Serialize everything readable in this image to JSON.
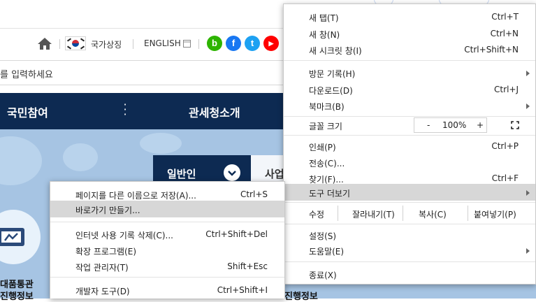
{
  "header": {
    "national_symbol": "국가상징",
    "english": "ENGLISH",
    "english_icon": "window-icon",
    "sns": [
      {
        "name": "blog",
        "glyph": "b",
        "color": "#2db400"
      },
      {
        "name": "facebook",
        "glyph": "f",
        "color": "#1877f2"
      },
      {
        "name": "twitter",
        "glyph": "t",
        "color": "#1da1f2"
      },
      {
        "name": "youtube",
        "glyph": "▶",
        "color": "#ff0000"
      }
    ]
  },
  "search": {
    "placeholder_partial": "를 입력하세요"
  },
  "nav": {
    "item_1": "국민참여",
    "item_2": "관세청소개"
  },
  "tabs": {
    "active": "일반인",
    "inactive": "사업"
  },
  "content": {
    "caption_left_1": "대품통관",
    "caption_left_2": "진행정보",
    "caption_right_1": "진행정보"
  },
  "chrome_menu": {
    "new_tab": {
      "label": "새 탭(T)",
      "shortcut": "Ctrl+T"
    },
    "new_window": {
      "label": "새 창(N)",
      "shortcut": "Ctrl+N"
    },
    "new_incognito": {
      "label": "새 시크릿 창(I)",
      "shortcut": "Ctrl+Shift+N"
    },
    "history": {
      "label": "방문 기록(H)"
    },
    "downloads": {
      "label": "다운로드(D)",
      "shortcut": "Ctrl+J"
    },
    "bookmarks": {
      "label": "북마크(B)"
    },
    "font_size": {
      "label": "글꼴 크기",
      "minus": "-",
      "value": "100%",
      "plus": "+"
    },
    "print": {
      "label": "인쇄(P)",
      "shortcut": "Ctrl+P"
    },
    "cast": {
      "label": "전송(C)..."
    },
    "find": {
      "label": "찾기(F)...",
      "shortcut": "Ctrl+F"
    },
    "more_tools": {
      "label": "도구 더보기"
    },
    "edit": {
      "label": "수정",
      "cut": "잘라내기(T)",
      "copy": "복사(C)",
      "paste": "붙여넣기(P)"
    },
    "settings": {
      "label": "설정(S)"
    },
    "help": {
      "label": "도움말(E)"
    },
    "exit": {
      "label": "종료(X)"
    }
  },
  "tools_submenu": {
    "save_as": {
      "label": "페이지를 다른 이름으로 저장(A)...",
      "shortcut": "Ctrl+S"
    },
    "create_shortcut": {
      "label": "바로가기 만들기..."
    },
    "clear_data": {
      "label": "인터넷 사용 기록 삭제(C)...",
      "shortcut": "Ctrl+Shift+Del"
    },
    "extensions": {
      "label": "확장 프로그램(E)"
    },
    "task_manager": {
      "label": "작업 관리자(T)",
      "shortcut": "Shift+Esc"
    },
    "dev_tools": {
      "label": "개발자 도구(D)",
      "shortcut": "Ctrl+Shift+I"
    }
  },
  "colors": {
    "nav_bg": "#0d2a52",
    "content_bg": "#a6c4e3",
    "highlight": "#d7d7d7"
  }
}
